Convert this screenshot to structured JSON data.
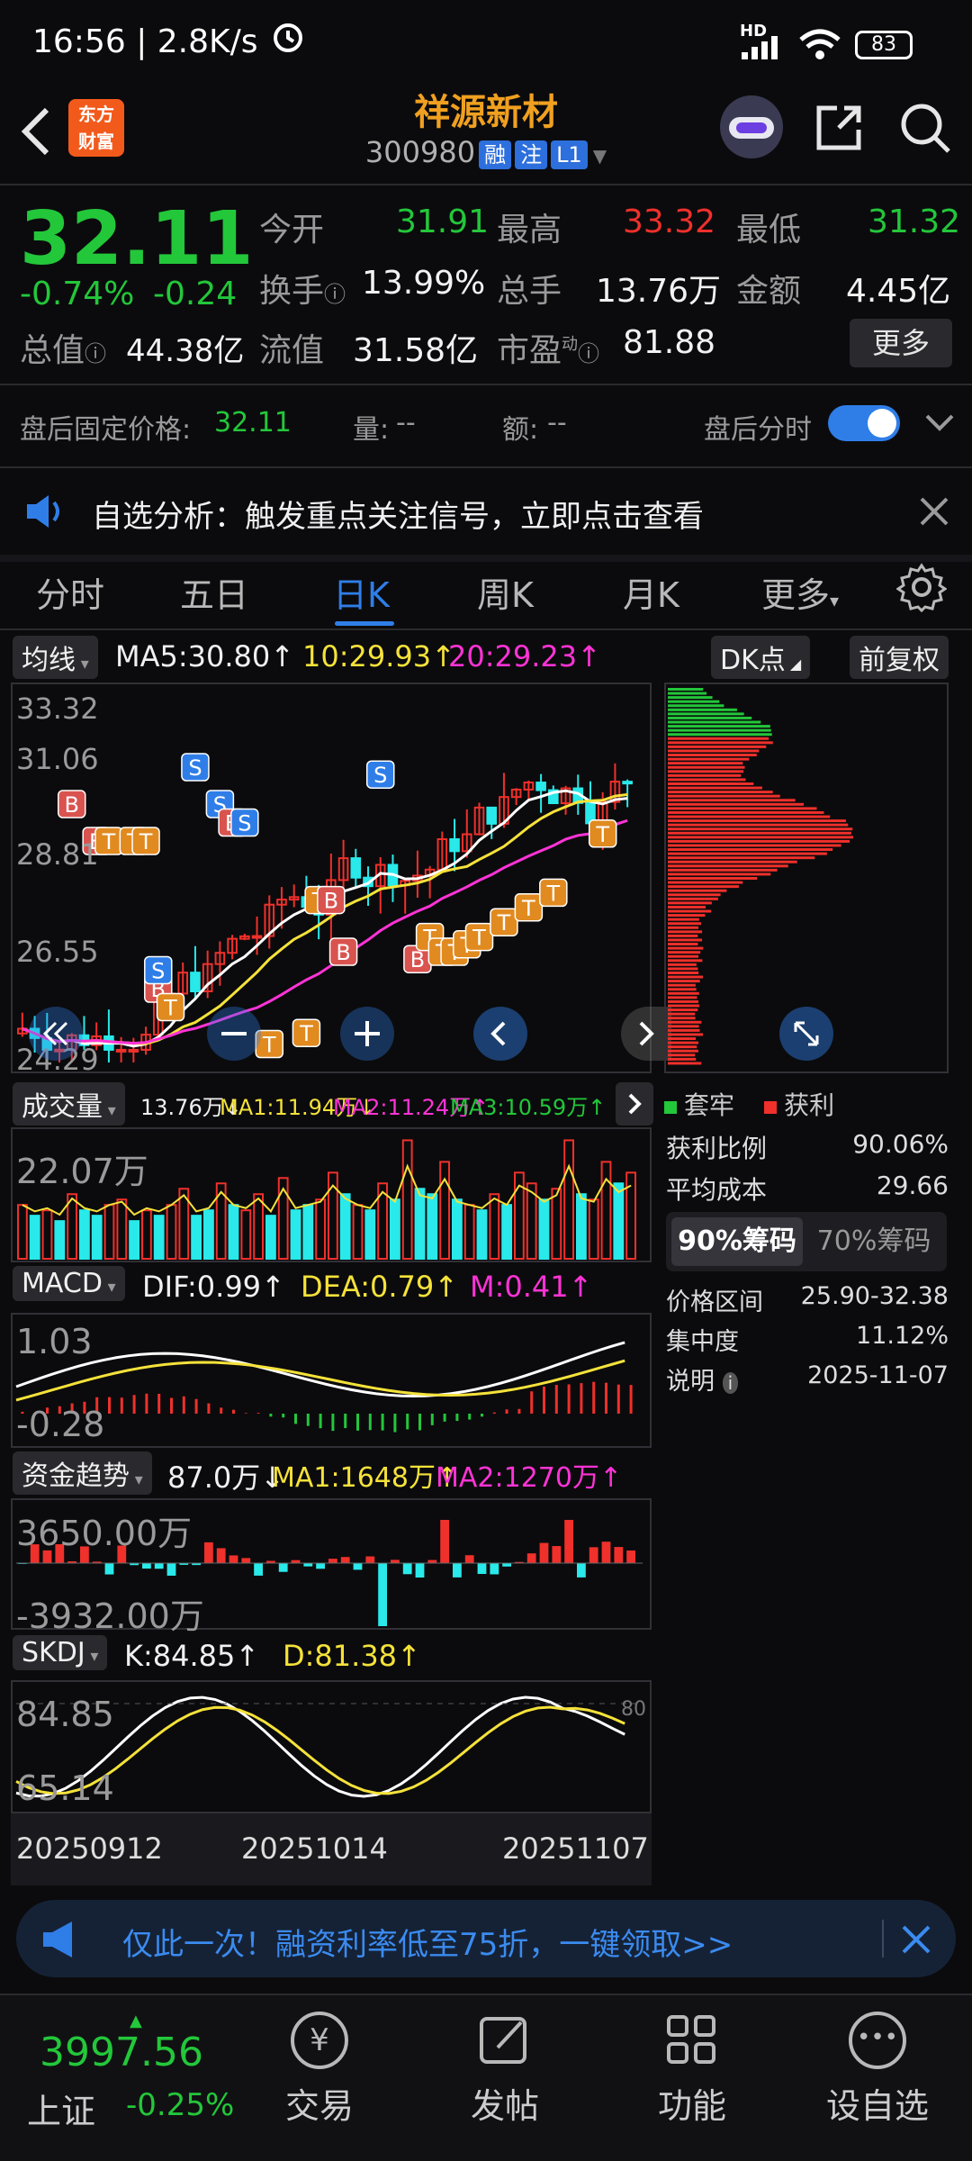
{
  "status_bar": {
    "time": "16:56 | 2.8K/s",
    "signal": "HD",
    "battery": "83"
  },
  "header": {
    "brand_logo": "东方\n财富",
    "name": "祥源新材",
    "code": "300980",
    "badges": [
      "融",
      "注",
      "L1"
    ]
  },
  "quote": {
    "price": "32.11",
    "change_pct": "-0.74%",
    "change": "-0.24",
    "fields": [
      {
        "label": "今开",
        "value": "31.91",
        "color": "green"
      },
      {
        "label": "最高",
        "value": "33.32",
        "color": "red"
      },
      {
        "label": "最低",
        "value": "31.32",
        "color": "green"
      },
      {
        "label": "换手",
        "value": "13.99%",
        "color": "white"
      },
      {
        "label": "总手",
        "value": "13.76万",
        "color": "white"
      },
      {
        "label": "金额",
        "value": "4.45亿",
        "color": "white"
      },
      {
        "label": "总值",
        "value": "44.38亿",
        "color": "white"
      },
      {
        "label": "流值",
        "value": "31.58亿",
        "color": "white"
      },
      {
        "label": "市盈",
        "value": "81.88",
        "color": "white"
      }
    ],
    "more_button": "更多",
    "pe_superscript": "动"
  },
  "after_hours": {
    "fixed_price_label": "盘后固定价格:",
    "fixed_price": "32.11",
    "volume_label": "量:",
    "volume": "--",
    "amount_label": "额:",
    "amount": "--",
    "toggle_label": "盘后分时",
    "toggle_on": true
  },
  "notice": {
    "text": "自选分析：触发重点关注信号，立即点击查看"
  },
  "tabs": [
    {
      "label": "分时",
      "active": false
    },
    {
      "label": "五日",
      "active": false
    },
    {
      "label": "日K",
      "active": true
    },
    {
      "label": "周K",
      "active": false
    },
    {
      "label": "月K",
      "active": false
    },
    {
      "label": "更多",
      "active": false
    }
  ],
  "kline": {
    "indicator_name": "均线",
    "ma5": "MA5:30.80↑",
    "ma10": "10:29.93↑",
    "ma20": "20:29.23↑",
    "dk_button": "DK点",
    "adjust_button": "前复权",
    "y_labels": [
      "33.32",
      "31.06",
      "28.81",
      "26.55",
      "24.29"
    ]
  },
  "volume_panel": {
    "name": "成交量",
    "v": "13.76万↓",
    "ma1": "MA1:11.94万↓",
    "ma2": "MA2:11.24万↑",
    "ma3": "MA3:10.59万↑",
    "y_label": "22.07万",
    "bars": [
      10,
      8,
      9,
      7,
      12,
      9,
      8,
      10,
      11,
      7,
      9,
      8,
      10,
      13,
      8,
      9,
      14,
      10,
      9,
      12,
      8,
      15,
      9,
      10,
      11,
      16,
      12,
      10,
      9,
      14,
      11,
      22,
      13,
      12,
      18,
      11,
      10,
      9,
      12,
      10,
      16,
      14,
      11,
      13,
      22,
      12,
      11,
      18,
      14,
      16
    ],
    "up": [
      1,
      0,
      1,
      0,
      1,
      0,
      0,
      1,
      1,
      0,
      1,
      0,
      1,
      1,
      0,
      0,
      1,
      0,
      1,
      1,
      0,
      1,
      0,
      0,
      1,
      1,
      0,
      1,
      0,
      1,
      0,
      1,
      0,
      0,
      1,
      0,
      1,
      0,
      1,
      0,
      1,
      1,
      0,
      1,
      1,
      0,
      1,
      1,
      0,
      1
    ]
  },
  "macd_panel": {
    "name": "MACD",
    "dif": "DIF:0.99↑",
    "dea": "DEA:0.79↑",
    "m": "M:0.41↑",
    "y_top": "1.03",
    "y_bottom": "-0.28"
  },
  "fund_panel": {
    "name": "资金趋势",
    "v": "87.0万↓",
    "ma1": "MA1:1648万↑",
    "ma2": "MA2:1270万↑",
    "y_top": "3650.00万",
    "y_bottom": "-3932.00万"
  },
  "skdj_panel": {
    "name": "SKDJ",
    "k": "K:84.85↑",
    "d": "D:81.38↑",
    "y_top": "84.85",
    "y_bottom": "65.14",
    "right_mark": "80",
    "dates": [
      "20250912",
      "20251014",
      "20251107"
    ]
  },
  "chips": {
    "legend_trapped": "套牢",
    "legend_profit": "获利",
    "rows": [
      {
        "label": "获利比例",
        "value": "90.06%"
      },
      {
        "label": "平均成本",
        "value": "29.66"
      }
    ],
    "tabs": [
      "90%筹码",
      "70%筹码"
    ],
    "rows2": [
      {
        "label": "价格区间",
        "value": "25.90-32.38"
      },
      {
        "label": "集中度",
        "value": "11.12%"
      },
      {
        "label": "说明",
        "value": "2025-11-07"
      }
    ]
  },
  "promo": {
    "text": "仅此一次！融资利率低至75折，一键领取>>"
  },
  "bottom_nav": {
    "index_value": "3997.56",
    "index_name": "上证",
    "index_change": "-0.25%",
    "items": [
      {
        "label": "交易",
        "icon": "yen-icon"
      },
      {
        "label": "发帖",
        "icon": "edit-icon"
      },
      {
        "label": "功能",
        "icon": "grid-icon"
      },
      {
        "label": "设自选",
        "icon": "more-icon"
      }
    ]
  },
  "colors": {
    "up": "#f0302b",
    "down": "#23c73a",
    "accent": "#f0a020",
    "toggle": "#2f7ee8",
    "bar_cyan": "#29e9ea"
  }
}
